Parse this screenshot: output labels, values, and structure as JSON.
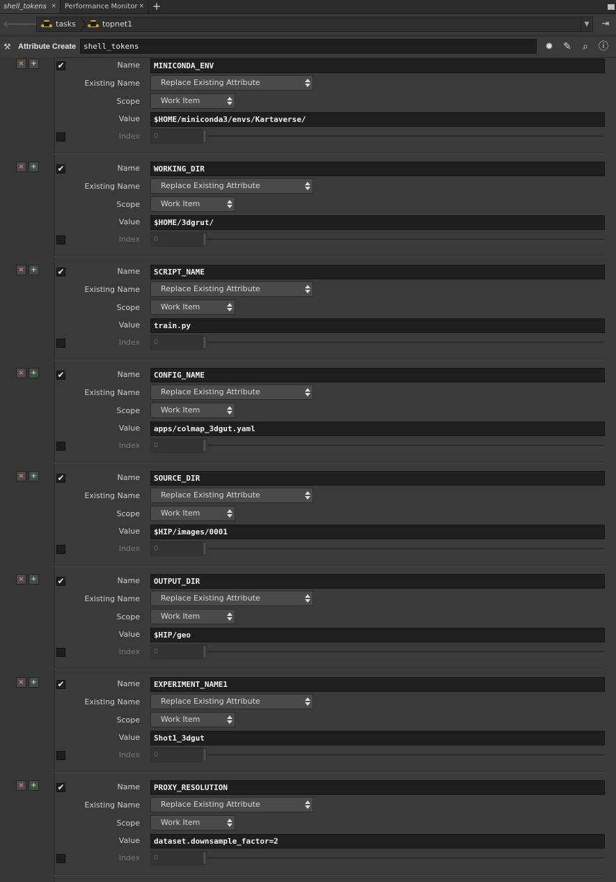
{
  "tabs": [
    {
      "label": "shell_tokens",
      "close": "×"
    },
    {
      "label": "Performance Monitor",
      "close": "×"
    }
  ],
  "add_tab": "+",
  "path": {
    "back": "🡐",
    "forward": "🡒",
    "crumbs": [
      "tasks",
      "topnet1"
    ],
    "dropdown": "▼",
    "pin": "⇥"
  },
  "node": {
    "type_label": "Attribute Create",
    "name": "shell_tokens"
  },
  "row_labels": {
    "name": "Name",
    "existing": "Existing Name",
    "scope": "Scope",
    "value": "Value",
    "index": "Index"
  },
  "row_buttons": {
    "delete": "×",
    "insert": "+"
  },
  "attributes": [
    {
      "name": "MINICONDA_ENV",
      "existing": "Replace Existing Attribute",
      "scope": "Work Item",
      "value": "$HOME/miniconda3/envs/Kartaverse/",
      "index": "0",
      "enabled": "✔"
    },
    {
      "name": "WORKING_DIR",
      "existing": "Replace Existing Attribute",
      "scope": "Work Item",
      "value": "$HOME/3dgrut/",
      "index": "0",
      "enabled": "✔"
    },
    {
      "name": "SCRIPT_NAME",
      "existing": "Replace Existing Attribute",
      "scope": "Work Item",
      "value": "train.py",
      "index": "0",
      "enabled": "✔"
    },
    {
      "name": "CONFIG_NAME",
      "existing": "Replace Existing Attribute",
      "scope": "Work Item",
      "value": "apps/colmap_3dgut.yaml",
      "index": "0",
      "enabled": "✔"
    },
    {
      "name": "SOURCE_DIR",
      "existing": "Replace Existing Attribute",
      "scope": "Work Item",
      "value": "$HIP/images/0001",
      "index": "0",
      "enabled": "✔"
    },
    {
      "name": "OUTPUT_DIR",
      "existing": "Replace Existing Attribute",
      "scope": "Work Item",
      "value": "$HIP/geo",
      "index": "0",
      "enabled": "✔"
    },
    {
      "name": "EXPERIMENT_NAME1",
      "existing": "Replace Existing Attribute",
      "scope": "Work Item",
      "value": "Shot1_3dgut",
      "index": "0",
      "enabled": "✔"
    },
    {
      "name": "PROXY_RESOLUTION",
      "existing": "Replace Existing Attribute",
      "scope": "Work Item",
      "value": "dataset.downsample_factor=2",
      "index": "0",
      "enabled": "✔"
    }
  ]
}
